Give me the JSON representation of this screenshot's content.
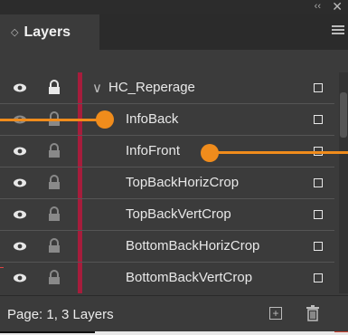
{
  "panel": {
    "tab_label": "Layers",
    "tab_arrows": "◇",
    "collapse_glyph": "‹‹",
    "close_glyph": "✕"
  },
  "parent_layer": {
    "name": "HC_Reperage",
    "expanded_glyph": "∨"
  },
  "layers": [
    {
      "name": "InfoBack"
    },
    {
      "name": "InfoFront"
    },
    {
      "name": "TopBackHorizCrop"
    },
    {
      "name": "TopBackVertCrop"
    },
    {
      "name": "BottomBackHorizCrop"
    },
    {
      "name": "BottomBackVertCrop"
    }
  ],
  "footer": {
    "status": "Page: 1, 3 Layers",
    "new_layer_glyph": "+"
  },
  "colors": {
    "panel_bg": "#3b3b3b",
    "layer_color": "#a61d3c",
    "callout": "#f08c1c"
  }
}
